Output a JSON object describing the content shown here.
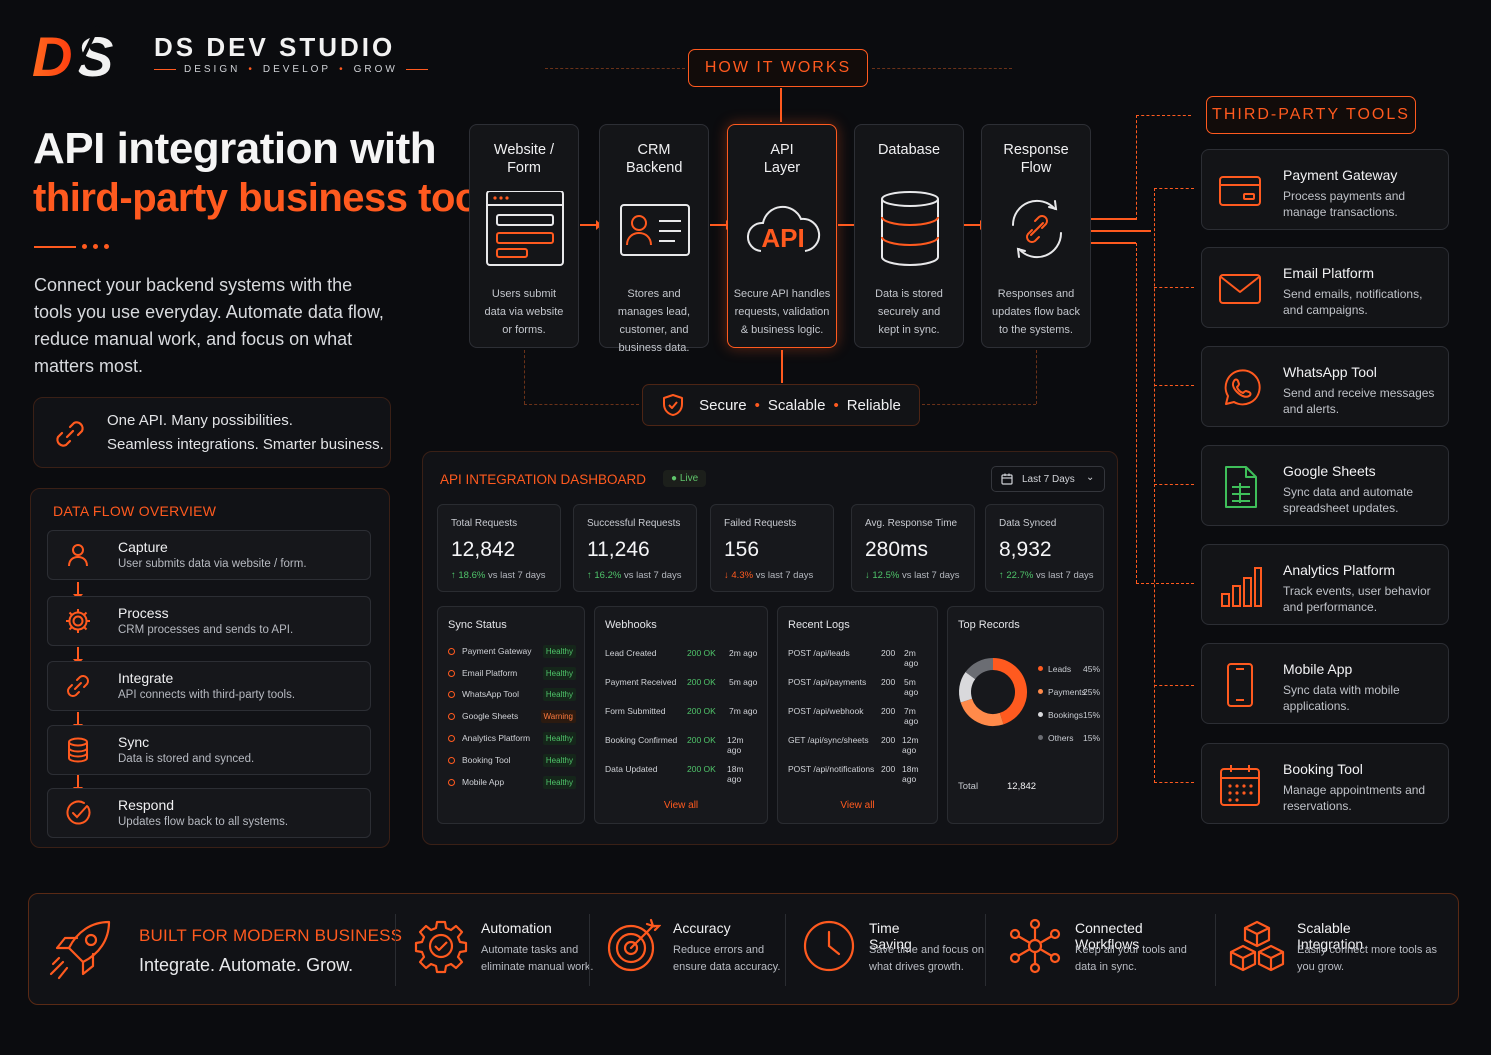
{
  "brand": {
    "name": "DS DEV STUDIO",
    "tag": [
      "DESIGN",
      "DEVELOP",
      "GROW"
    ],
    "mark_text": "DS"
  },
  "headline": {
    "line1": "API integration with",
    "line2": "third-party business tools"
  },
  "intro": "Connect your backend systems with the tools you use everyday. Automate data flow, reduce manual work, and focus on what matters most.",
  "tagline": {
    "line1": "One API. Many possibilities.",
    "line2": "Seamless integrations. Smarter business."
  },
  "data_flow": {
    "title": "DATA FLOW OVERVIEW",
    "items": [
      {
        "title": "Capture",
        "desc": "User submits data via website / form.",
        "icon": "user-icon"
      },
      {
        "title": "Process",
        "desc": "CRM processes and sends to API.",
        "icon": "gear-icon"
      },
      {
        "title": "Integrate",
        "desc": "API connects with third-party tools.",
        "icon": "link-icon"
      },
      {
        "title": "Sync",
        "desc": "Data is stored and synced.",
        "icon": "database-icon"
      },
      {
        "title": "Respond",
        "desc": "Updates flow back to all systems.",
        "icon": "check-circle-icon"
      }
    ]
  },
  "how_it_works": {
    "label": "HOW IT WORKS",
    "steps": [
      {
        "title": "Website / Form",
        "desc": "Users submit data via website or forms.",
        "icon": "browser-form-icon"
      },
      {
        "title": "CRM Backend",
        "desc": "Stores and manages lead, customer, and business data.",
        "icon": "contact-card-icon"
      },
      {
        "title": "API Layer",
        "desc": "Secure API handles requests, validation & business logic.",
        "icon": "api-cloud-icon",
        "icon_text": "API"
      },
      {
        "title": "Database",
        "desc": "Data is stored securely and kept in sync.",
        "icon": "database-icon"
      },
      {
        "title": "Response Flow",
        "desc": "Responses and updates flow back to the systems.",
        "icon": "sync-link-icon"
      }
    ],
    "badge": [
      "Secure",
      "Scalable",
      "Reliable"
    ]
  },
  "dashboard": {
    "title": "API INTEGRATION DASHBOARD",
    "live": "Live",
    "range": "Last 7 Days",
    "kpis": [
      {
        "label": "Total Requests",
        "value": "12,842",
        "change": "18.6%",
        "dir": "up",
        "suffix": "vs last 7 days"
      },
      {
        "label": "Successful Requests",
        "value": "11,246",
        "change": "16.2%",
        "dir": "up",
        "suffix": "vs last 7 days"
      },
      {
        "label": "Failed Requests",
        "value": "156",
        "change": "4.3%",
        "dir": "down",
        "suffix": "vs last 7 days"
      },
      {
        "label": "Avg. Response Time",
        "value": "280ms",
        "change": "12.5%",
        "dir": "down-good",
        "suffix": "vs last 7 days"
      },
      {
        "label": "Data Synced",
        "value": "8,932",
        "change": "22.7%",
        "dir": "up",
        "suffix": "vs last 7 days"
      }
    ],
    "sync_status": {
      "title": "Sync Status",
      "rows": [
        {
          "name": "Payment Gateway",
          "status": "Healthy"
        },
        {
          "name": "Email Platform",
          "status": "Healthy"
        },
        {
          "name": "WhatsApp Tool",
          "status": "Healthy"
        },
        {
          "name": "Google Sheets",
          "status": "Warning"
        },
        {
          "name": "Analytics Platform",
          "status": "Healthy"
        },
        {
          "name": "Booking Tool",
          "status": "Healthy"
        },
        {
          "name": "Mobile App",
          "status": "Healthy"
        }
      ]
    },
    "webhooks": {
      "title": "Webhooks",
      "rows": [
        {
          "event": "Lead Created",
          "status": "200 OK",
          "time": "2m ago"
        },
        {
          "event": "Payment Received",
          "status": "200 OK",
          "time": "5m ago"
        },
        {
          "event": "Form Submitted",
          "status": "200 OK",
          "time": "7m ago"
        },
        {
          "event": "Booking Confirmed",
          "status": "200 OK",
          "time": "12m ago"
        },
        {
          "event": "Data Updated",
          "status": "200 OK",
          "time": "18m ago"
        }
      ],
      "view_all": "View all"
    },
    "logs": {
      "title": "Recent Logs",
      "rows": [
        {
          "call": "POST /api/leads",
          "code": "200",
          "time": "2m ago"
        },
        {
          "call": "POST /api/payments",
          "code": "200",
          "time": "5m ago"
        },
        {
          "call": "POST /api/webhook",
          "code": "200",
          "time": "7m ago"
        },
        {
          "call": "GET /api/sync/sheets",
          "code": "200",
          "time": "12m ago"
        },
        {
          "call": "POST /api/notifications",
          "code": "200",
          "time": "18m ago"
        }
      ],
      "view_all": "View all"
    },
    "top_records": {
      "title": "Top Records",
      "total_label": "Total",
      "total_value": "12,842"
    }
  },
  "chart_data": {
    "type": "pie",
    "title": "Top Records",
    "categories": [
      "Leads",
      "Payments",
      "Bookings",
      "Others"
    ],
    "values": [
      45,
      25,
      15,
      15
    ],
    "colors": [
      "#ff5a1f",
      "#ff8a4a",
      "#d9d9dc",
      "#6b6d73"
    ]
  },
  "third_party": {
    "label": "THIRD-PARTY TOOLS",
    "tools": [
      {
        "title": "Payment Gateway",
        "desc": "Process payments and manage transactions.",
        "icon": "credit-card-icon"
      },
      {
        "title": "Email Platform",
        "desc": "Send emails, notifications, and campaigns.",
        "icon": "envelope-icon"
      },
      {
        "title": "WhatsApp Tool",
        "desc": "Send and receive messages and alerts.",
        "icon": "whatsapp-icon"
      },
      {
        "title": "Google Sheets",
        "desc": "Sync data and automate spreadsheet updates.",
        "icon": "spreadsheet-icon"
      },
      {
        "title": "Analytics Platform",
        "desc": "Track events, user behavior and performance.",
        "icon": "bar-chart-icon"
      },
      {
        "title": "Mobile App",
        "desc": "Sync data with mobile applications.",
        "icon": "smartphone-icon"
      },
      {
        "title": "Booking Tool",
        "desc": "Manage appointments and reservations.",
        "icon": "calendar-icon"
      }
    ]
  },
  "bottom": {
    "title": "BUILT FOR MODERN BUSINESS",
    "subtitle": "Integrate. Automate. Grow.",
    "features": [
      {
        "title": "Automation",
        "desc": "Automate tasks and eliminate manual work.",
        "icon": "gear-check-icon"
      },
      {
        "title": "Accuracy",
        "desc": "Reduce errors and ensure data accuracy.",
        "icon": "target-icon"
      },
      {
        "title": "Time Saving",
        "desc": "Save time and focus on what drives growth.",
        "icon": "clock-icon"
      },
      {
        "title": "Connected Workflows",
        "desc": "Keep all your tools and data in sync.",
        "icon": "network-icon"
      },
      {
        "title": "Scalable Integration",
        "desc": "Easily connect more tools as you grow.",
        "icon": "cubes-icon"
      }
    ]
  },
  "colors": {
    "accent": "#ff5a1f",
    "background": "#0b0c0f",
    "success": "#4fc46a",
    "warning": "#ff7a3d"
  }
}
